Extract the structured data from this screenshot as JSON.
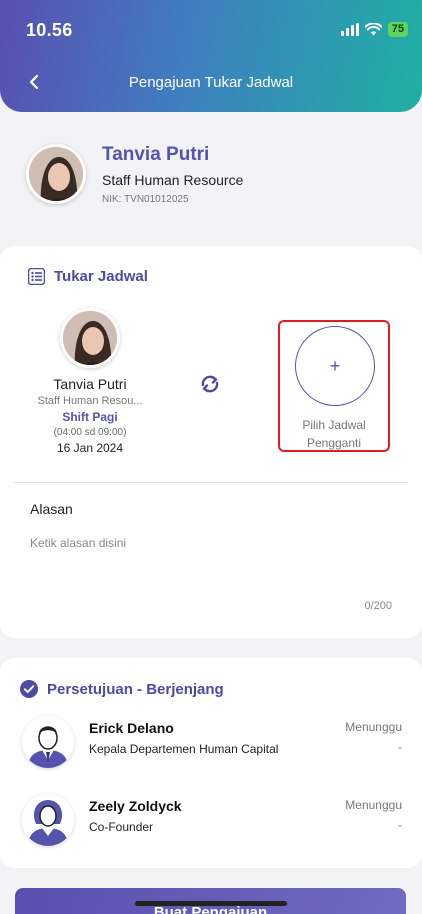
{
  "status_bar": {
    "time": "10.56",
    "battery": "75"
  },
  "header": {
    "title": "Pengajuan Tukar Jadwal",
    "back_icon": "chevron-left-icon"
  },
  "profile": {
    "name": "Tanvia Putri",
    "role": "Staff Human Resource",
    "nik": "NIK: TVN01012025"
  },
  "swap": {
    "title": "Tukar Jadwal",
    "current": {
      "name": "Tanvia Putri",
      "role": "Staff Human Resou...",
      "shift": "Shift Pagi",
      "time": "(04:00 sd 09:00)",
      "date": "16 Jan 2024"
    },
    "pick": {
      "plus": "+",
      "label_line1": "Pilih Jadwal",
      "label_line2": "Pengganti"
    },
    "reason": {
      "label": "Alasan",
      "placeholder": "Ketik alasan disini",
      "counter": "0/200"
    }
  },
  "approval": {
    "title": "Persetujuan - Berjenjang",
    "items": [
      {
        "name": "Erick Delano",
        "role": "Kepala Departemen Human Capital",
        "status": "Menunggu",
        "date": "-"
      },
      {
        "name": "Zeely Zoldyck",
        "role": "Co-Founder",
        "status": "Menunggu",
        "date": "-"
      }
    ]
  },
  "submit": {
    "label": "Buat Pengajuan"
  },
  "colors": {
    "primary": "#5553ad",
    "accent_teal": "#1fb0a3",
    "highlight_red": "#e01d22"
  }
}
